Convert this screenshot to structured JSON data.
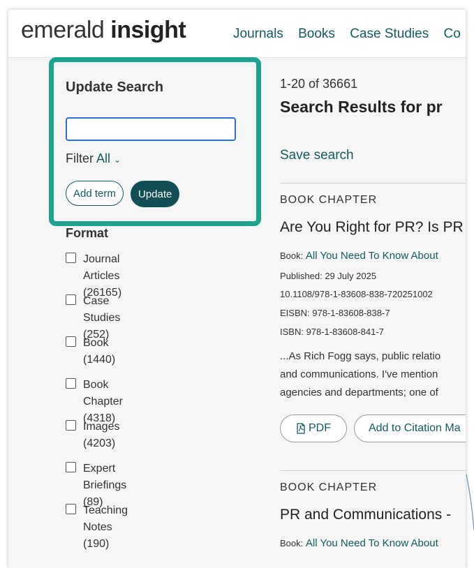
{
  "header": {
    "logo_light": "emerald",
    "logo_bold": "insight",
    "nav": [
      "Journals",
      "Books",
      "Case Studies",
      "Co"
    ]
  },
  "update_search": {
    "title": "Update Search",
    "input_value": "",
    "filter_label": "Filter",
    "filter_value": "All",
    "add_term_label": "Add term",
    "update_label": "Update"
  },
  "format": {
    "title": "Format",
    "items": [
      {
        "label": "Journal Articles",
        "count": "(26165)"
      },
      {
        "label": "Case Studies",
        "count": "(252)"
      },
      {
        "label": "Book",
        "count": "(1440)"
      },
      {
        "label": "Book Chapter",
        "count": "(4318)"
      },
      {
        "label": "Images",
        "count": "(4203)"
      },
      {
        "label": "Expert Briefings",
        "count": "(89)"
      },
      {
        "label": "Teaching Notes",
        "count": "(190)"
      }
    ]
  },
  "results": {
    "count": "1-20 of 36661",
    "title": "Search Results for pr",
    "save_search": "Save search",
    "items": [
      {
        "type": "BOOK CHAPTER",
        "title": "Are You Right for PR? Is PR",
        "book_label": "Book:",
        "book_title": "All You Need To Know About",
        "published": "Published: 29 July 2025",
        "doi": "10.1108/978-1-83608-838-720251002",
        "eisbn": "EISBN: 978-1-83608-838-7",
        "isbn": "ISBN: 978-1-83608-841-7",
        "snippet": [
          "...As Rich Fogg says, public relatio",
          "and communications. I've mention",
          "agencies and departments; one of"
        ],
        "pdf_label": "PDF",
        "cite_label": "Add to Citation Ma"
      },
      {
        "type": "BOOK CHAPTER",
        "title": "PR and Communications -",
        "book_label": "Book:",
        "book_title": "All You Need To Know About"
      }
    ]
  },
  "colors": {
    "accent": "#135b5e",
    "highlight_border": "#1ea38f",
    "update_button": "#124e55",
    "input_border": "#2b6fd6"
  }
}
